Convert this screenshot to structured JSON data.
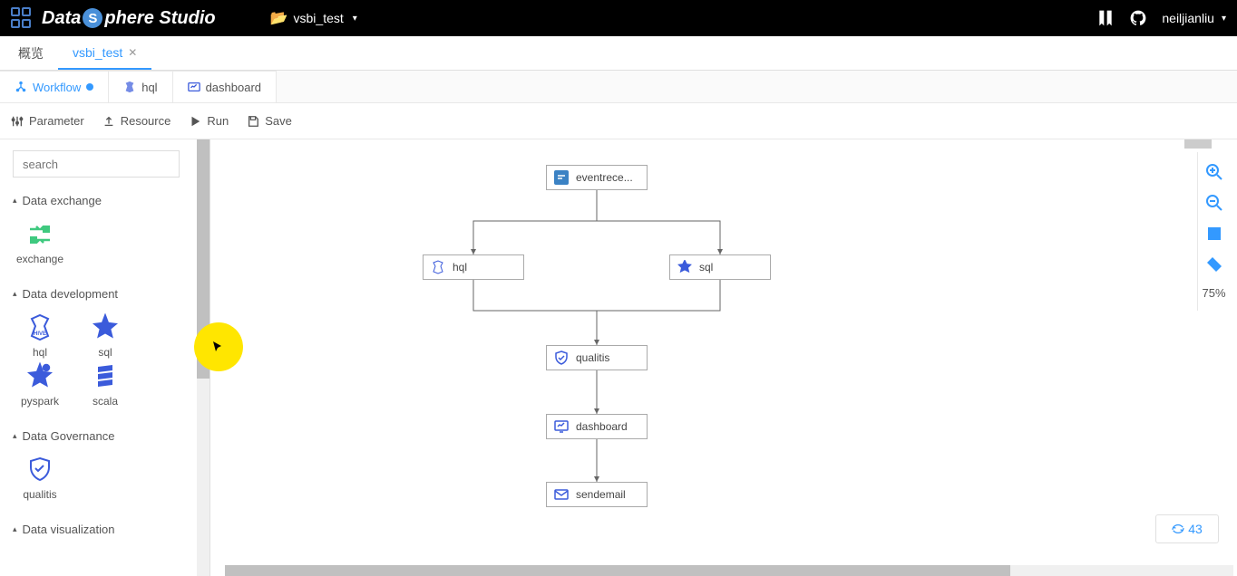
{
  "header": {
    "logo_text_1": "Data",
    "logo_text_s": "S",
    "logo_text_2": "phere Studio",
    "project": "vsbi_test",
    "user": "neiljianliu"
  },
  "top_tabs": [
    {
      "label": "概览",
      "active": false,
      "closable": false
    },
    {
      "label": "vsbi_test",
      "active": true,
      "closable": true
    }
  ],
  "sub_tabs": [
    {
      "label": "Workflow",
      "active": true,
      "dot": true
    },
    {
      "label": "hql",
      "active": false
    },
    {
      "label": "dashboard",
      "active": false
    }
  ],
  "toolbar": {
    "parameter": "Parameter",
    "resource": "Resource",
    "run": "Run",
    "save": "Save"
  },
  "sidebar": {
    "search_placeholder": "search",
    "categories": [
      {
        "name": "Data exchange",
        "items": [
          {
            "label": "exchange"
          }
        ]
      },
      {
        "name": "Data development",
        "items": [
          {
            "label": "hql"
          },
          {
            "label": "sql"
          },
          {
            "label": "pyspark"
          },
          {
            "label": "scala"
          }
        ]
      },
      {
        "name": "Data Governance",
        "items": [
          {
            "label": "qualitis"
          }
        ]
      },
      {
        "name": "Data visualization",
        "items": []
      }
    ]
  },
  "flow_nodes": {
    "eventrece": "eventrece...",
    "hql": "hql",
    "sql": "sql",
    "qualitis": "qualitis",
    "dashboard": "dashboard",
    "sendemail": "sendemail"
  },
  "zoom": {
    "value": "75%"
  },
  "edit_count": "43"
}
